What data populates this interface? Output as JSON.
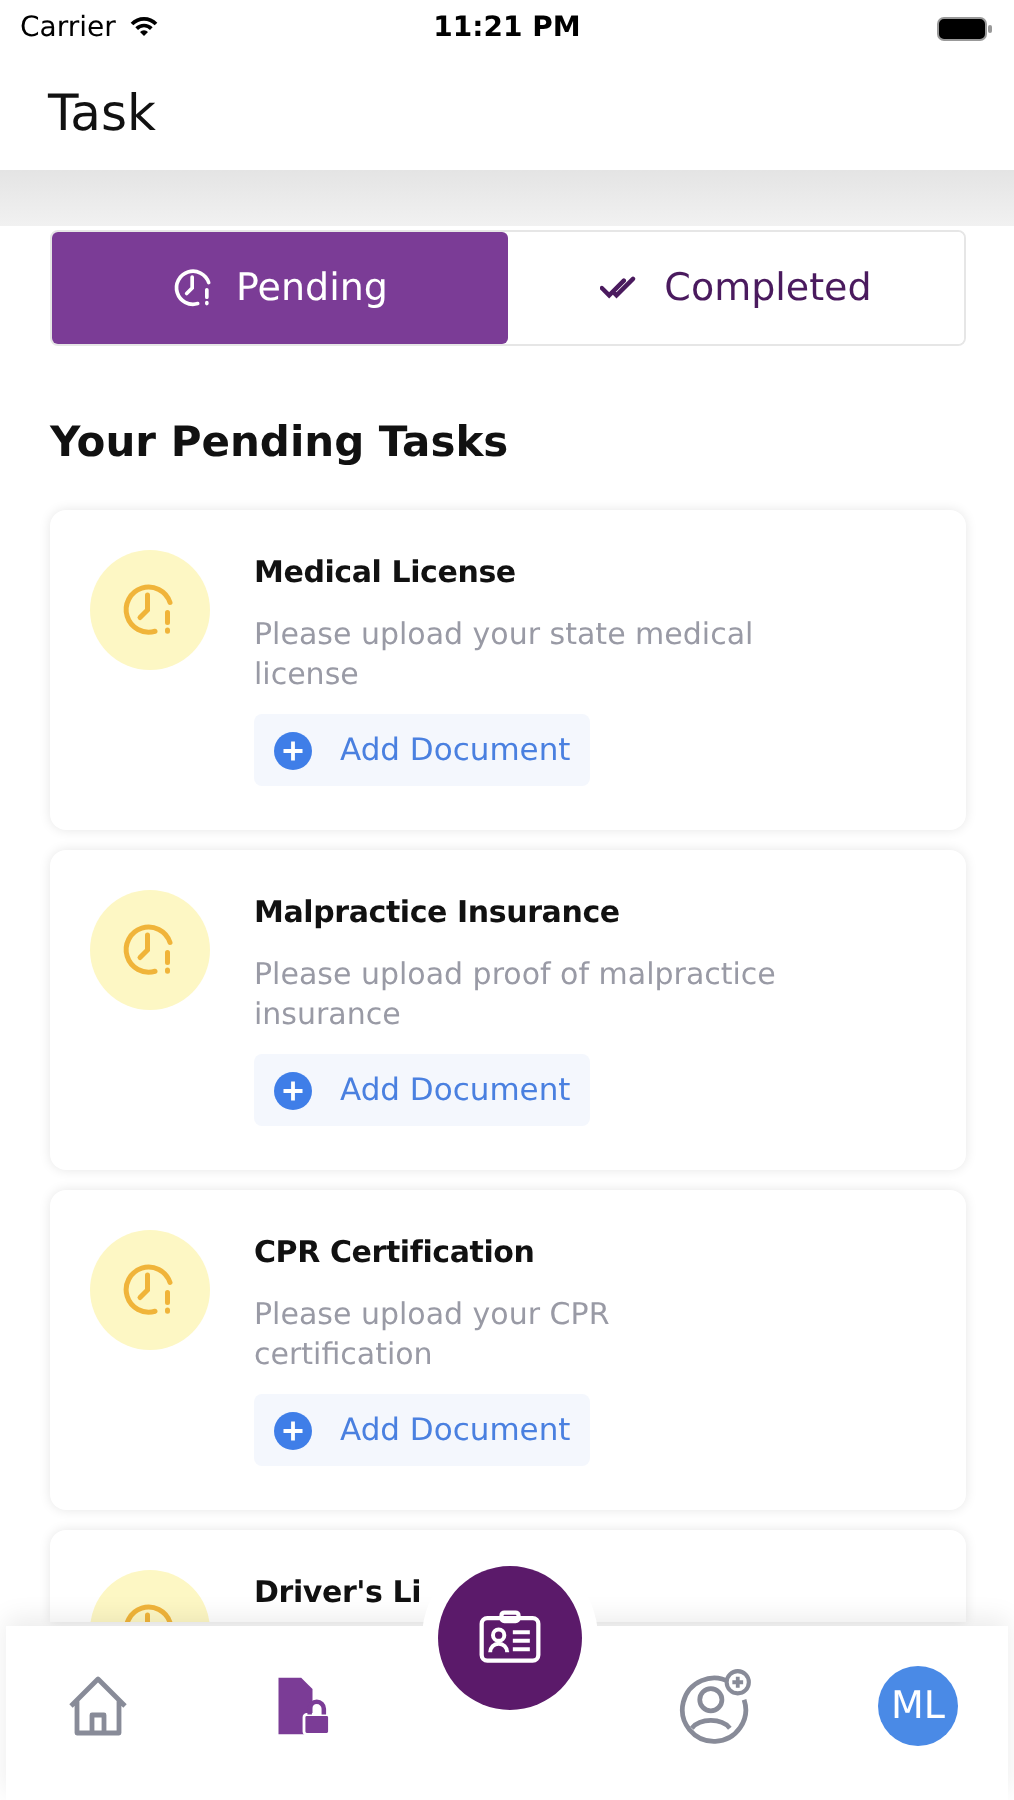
{
  "status_bar": {
    "carrier": "Carrier",
    "time": "11:21 PM"
  },
  "header": {
    "title": "Task"
  },
  "tabs": [
    {
      "label": "Pending",
      "selected": true
    },
    {
      "label": "Completed",
      "selected": false
    }
  ],
  "section_title": "Your Pending Tasks",
  "tasks": [
    {
      "title": "Medical License",
      "description": "Please upload your state medical license",
      "action": "Add Document"
    },
    {
      "title": "Malpractice Insurance",
      "description": "Please upload proof of malpractice insurance",
      "action": "Add Document"
    },
    {
      "title": "CPR Certification",
      "description": "Please upload your CPR certification",
      "action": "Add Document"
    },
    {
      "title": "Driver's Li"
    }
  ],
  "bottom_nav": [
    {
      "kind": "home",
      "selected": false
    },
    {
      "kind": "documents",
      "selected": true
    },
    {
      "kind": "center",
      "selected": false
    },
    {
      "kind": "add-user",
      "selected": false
    },
    {
      "kind": "avatar",
      "initials": "ML",
      "selected": false
    }
  ]
}
